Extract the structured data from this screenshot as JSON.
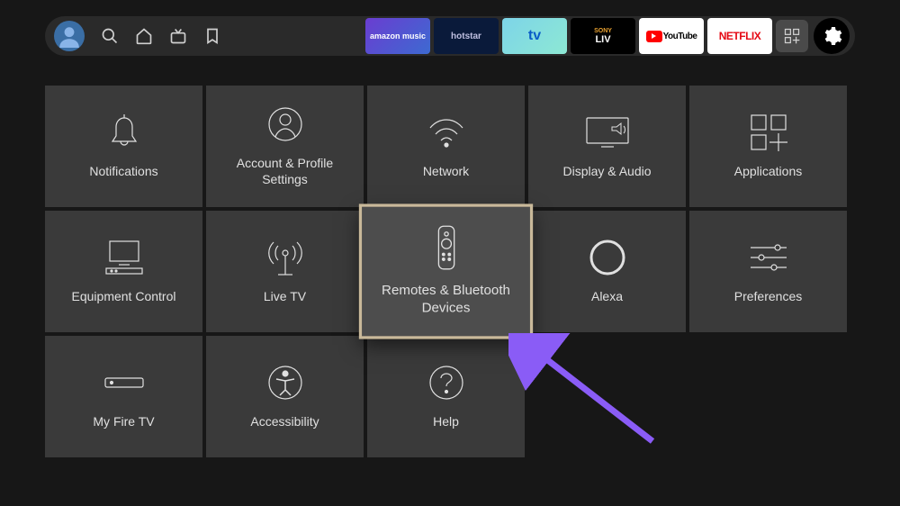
{
  "topApps": {
    "amazonmusic": "amazon music",
    "hotstar": "hotstar",
    "tv": "tv",
    "sonyliv_top": "SONY",
    "sonyliv_bottom": "LIV",
    "youtube": "YouTube",
    "netflix": "NETFLIX"
  },
  "tiles": [
    {
      "label": "Notifications",
      "icon": "bell"
    },
    {
      "label": "Account & Profile Settings",
      "icon": "profile"
    },
    {
      "label": "Network",
      "icon": "wifi"
    },
    {
      "label": "Display & Audio",
      "icon": "display-audio"
    },
    {
      "label": "Applications",
      "icon": "apps"
    },
    {
      "label": "Equipment Control",
      "icon": "equipment"
    },
    {
      "label": "Live TV",
      "icon": "antenna"
    },
    {
      "label": "Remotes & Bluetooth Devices",
      "icon": "remote",
      "selected": true
    },
    {
      "label": "Alexa",
      "icon": "alexa"
    },
    {
      "label": "Preferences",
      "icon": "sliders"
    },
    {
      "label": "My Fire TV",
      "icon": "firetv"
    },
    {
      "label": "Accessibility",
      "icon": "accessibility"
    },
    {
      "label": "Help",
      "icon": "help"
    }
  ],
  "colors": {
    "accent_arrow": "#8a5cf6",
    "tile_highlight_border": "#c9b99a"
  }
}
